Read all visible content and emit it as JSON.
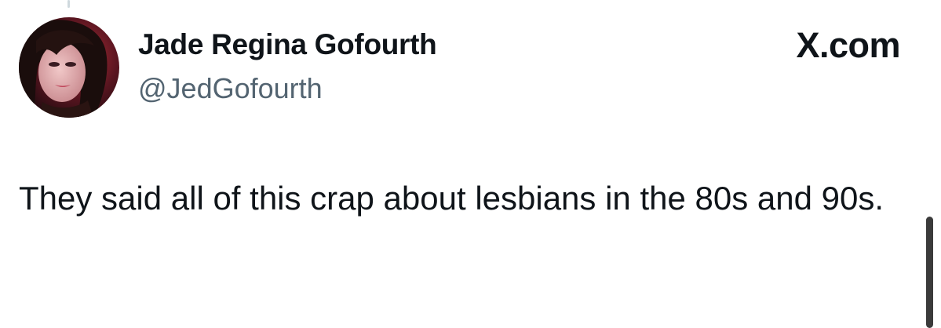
{
  "tweet": {
    "display_name": "Jade Regina Gofourth",
    "handle": "@JedGofourth",
    "brand": "X.com",
    "text": "They said all of this crap about lesbians in the 80s and 90s."
  },
  "colors": {
    "text_primary": "#0f1419",
    "text_secondary": "#536471",
    "background": "#ffffff"
  }
}
